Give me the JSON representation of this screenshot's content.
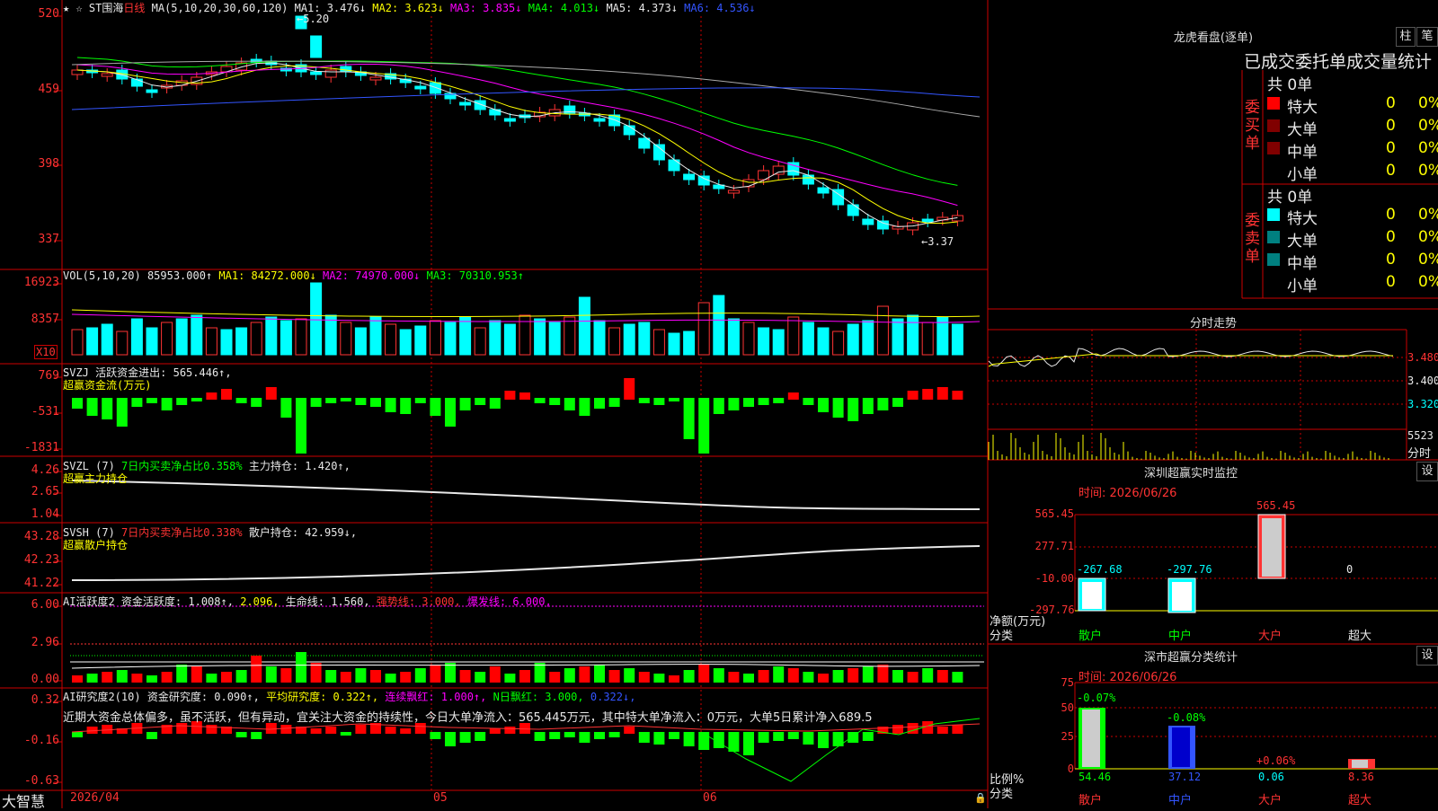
{
  "main": {
    "stock": "ST围海",
    "period": "日线",
    "ma_label": "MA(5,10,20,30,60,120)",
    "ma1": "MA1: 3.476↓",
    "ma2": "MA2: 3.623↓",
    "ma3": "MA3: 3.835↓",
    "ma4": "MA4: 4.013↓",
    "ma5": "MA5: 4.373↓",
    "ma6": "MA6: 4.536↓",
    "axis": [
      "520",
      "459",
      "398",
      "337"
    ],
    "high_marker": "5.20",
    "low_marker": "3.37",
    "colors": {
      "ma1": "#e8e8e8",
      "ma2": "#ffff00",
      "ma3": "#ff00ff",
      "ma4": "#00ff00",
      "ma5": "#aaaaaa",
      "ma6": "#3355ff",
      "up": "#ff3333",
      "down": "#00ffff"
    }
  },
  "vol": {
    "label": "VOL(5,10,20)",
    "value": "85953.000↑",
    "ma1": "MA1: 84272.000↓",
    "ma2": "MA2: 74970.000↓",
    "ma3": "MA3: 70310.953↑",
    "axis": [
      "16923",
      "8357"
    ],
    "unit": "X10"
  },
  "svzj": {
    "label": "SVZJ",
    "t1": "活跃资金进出: 565.446↑,",
    "t2": "超赢资金流(万元)",
    "axis": [
      "769",
      "-531",
      "-1831"
    ]
  },
  "svzl": {
    "label": "SVZL (7)",
    "t1": "7日内买卖净占比0.358%",
    "t2": "主力持仓: 1.420↑,",
    "t3": "超赢主力持仓",
    "axis": [
      "4.26",
      "2.65",
      "1.04"
    ]
  },
  "svsh": {
    "label": "SVSH (7)",
    "t1": "7日内买卖净占比0.338%",
    "t2": "散户持仓: 42.959↓,",
    "t3": "超赢散户持仓",
    "axis": [
      "43.28",
      "42.23",
      "41.22"
    ]
  },
  "ai1": {
    "label": "AI活跃度2",
    "t1": "资金活跃度: 1.008↑,",
    "t2": "2.096,",
    "t3": "生命线: 1.560,",
    "t4": "强势线: 3.000,",
    "t5": "爆发线: 6.000,",
    "axis": [
      "6.00",
      "2.96",
      "0.00"
    ]
  },
  "ai2": {
    "label": "AI研究度2(10)",
    "t1": "资金研究度: 0.090↑,",
    "t2": "平均研究度: 0.322↑,",
    "t3": "连续飘红: 1.000↑,",
    "t4": "N日飘红: 3.000,",
    "t5": "0.322↓,",
    "axis": [
      "0.32",
      "-0.16",
      "-0.63"
    ],
    "note": "近期大资金总体偏多，虽不活跃，但有异动，宜关注大资金的持续性，今日大单净流入：565.445万元，其中特大单净流入：0万元，大单5日累计净入689.5"
  },
  "xaxis": {
    "brand": "大智慧",
    "d1": "2026/04",
    "d2": "05",
    "d3": "06"
  },
  "lhb": {
    "title": "龙虎看盘(逐单)",
    "btn1": "柱",
    "btn2": "笔",
    "subtitle": "已成交委托单成交量统计",
    "buy_side": "委买单",
    "sell_side": "委卖单",
    "buy_total": "共 0单",
    "sell_total": "共 0单",
    "rows": [
      {
        "name": "特大",
        "n": "0",
        "p": "0%"
      },
      {
        "name": "大单",
        "n": "0",
        "p": "0%"
      },
      {
        "name": "中单",
        "n": "0",
        "p": "0%"
      },
      {
        "name": "小单",
        "n": "0",
        "p": "0%"
      }
    ]
  },
  "fs": {
    "title": "分时走势",
    "axis": [
      "3.480",
      "3.400",
      "3.320"
    ],
    "vol": "5523",
    "vol_label": "分时"
  },
  "sz": {
    "title": "深圳超赢实时监控",
    "btn": "设",
    "time": "时间: 2026/06/26",
    "axis": [
      "565.45",
      "277.71",
      "-10.00",
      "-297.76"
    ],
    "ylabel": "净额(万元)",
    "xlabel": "分类",
    "values": [
      "-267.68",
      "-297.76",
      "565.45",
      "0"
    ],
    "cats": [
      "散户",
      "中户",
      "大户",
      "超大"
    ]
  },
  "sc": {
    "title": "深市超赢分类统计",
    "btn": "设",
    "time": "时间: 2026/06/26",
    "axis": [
      "75",
      "50",
      "25",
      "0"
    ],
    "ylabel": "比例%",
    "xlabel": "分类",
    "top": [
      "-0.07%",
      "-0.08%",
      "+0.06%",
      ""
    ],
    "bottom": [
      "54.46",
      "37.12",
      "0.06",
      "8.36"
    ],
    "cats": [
      "散户",
      "中户",
      "大户",
      "超大"
    ]
  }
}
